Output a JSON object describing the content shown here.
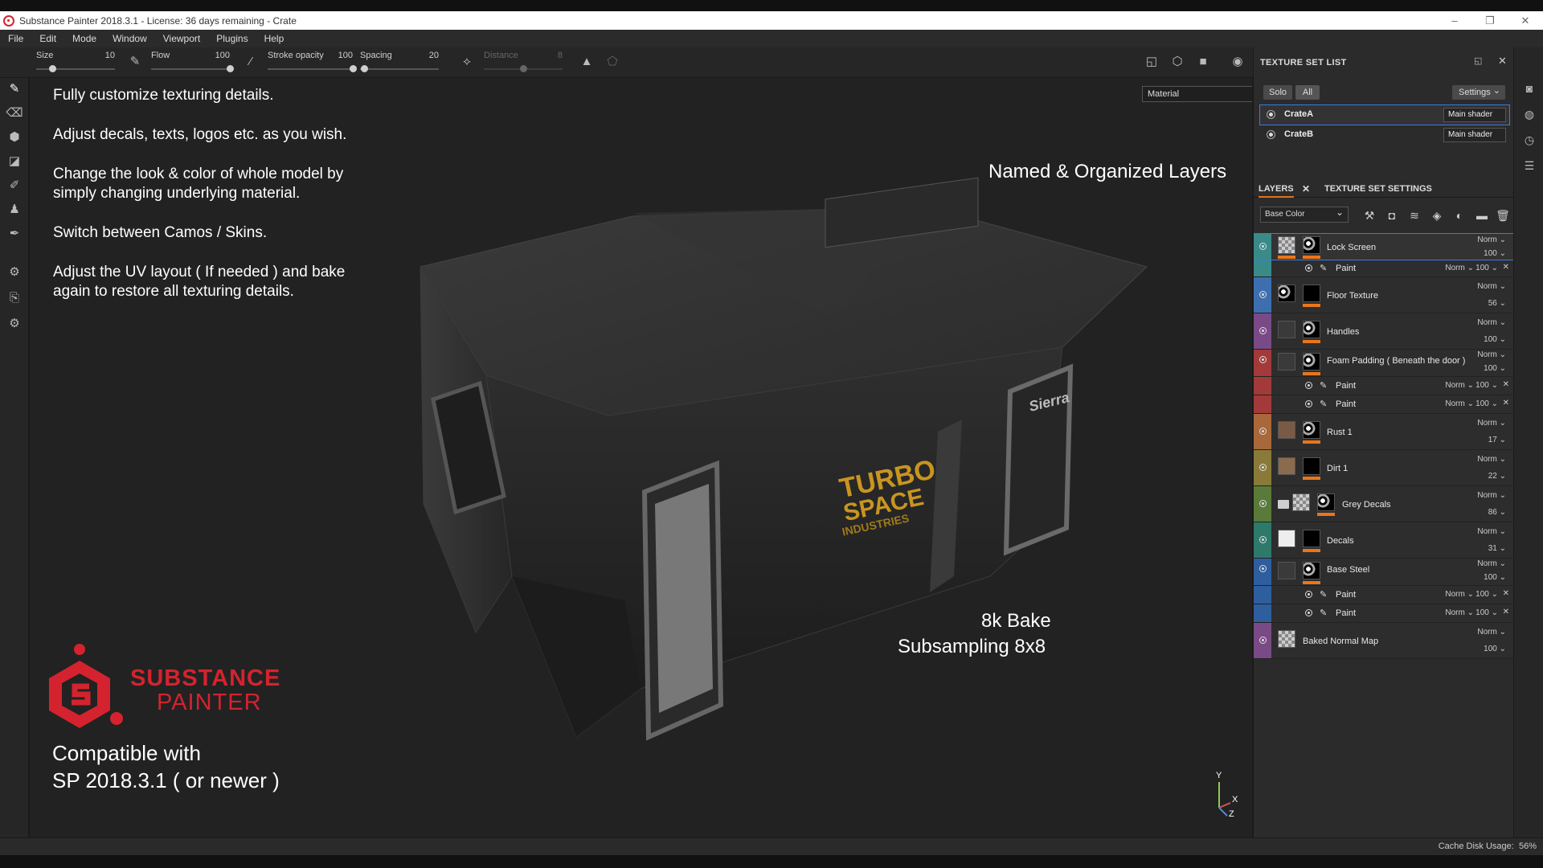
{
  "window": {
    "title": "Substance Painter 2018.3.1 - License: 36 days remaining - Crate",
    "controls": [
      "–",
      "❐",
      "✕"
    ]
  },
  "menu": [
    "File",
    "Edit",
    "Mode",
    "Window",
    "Viewport",
    "Plugins",
    "Help"
  ],
  "toolbar": {
    "size": {
      "label": "Size",
      "value": "10",
      "level": 0.2
    },
    "flow": {
      "label": "Flow",
      "value": "100",
      "level": 1.0
    },
    "stroke_opacity": {
      "label": "Stroke opacity",
      "value": "100",
      "level": 1.0
    },
    "spacing": {
      "label": "Spacing",
      "value": "20",
      "level": 0.05
    },
    "distance": {
      "label": "Distance",
      "value": "8",
      "level": 0.5
    }
  },
  "viewport": {
    "material_select": "Material",
    "lines": [
      "Fully customize texturing details.",
      "Adjust decals, texts, logos etc. as you wish.",
      "Change the look & color of whole model by",
      "simply changing underlying material.",
      "Switch between  Camos / Skins.",
      "Adjust the UV layout ( If needed ) and bake",
      "again to restore all texturing details."
    ],
    "named_layers": "Named & Organized Layers",
    "bake_line1": "8k Bake",
    "bake_line2": "Subsampling 8x8",
    "brand_line1": "SUBSTANCE",
    "brand_line2": "PAINTER",
    "compat_line1": "Compatible with",
    "compat_line2": "SP 2018.3.1 ( or newer  )",
    "crate_text1": "TURBO",
    "crate_text2": "SPACE",
    "crate_text3": "INDUSTRIES",
    "crate_side": "Sierra",
    "axis_y": "Y",
    "axis_x": "X",
    "axis_z": "Z"
  },
  "texture_set_list": {
    "title": "TEXTURE SET LIST",
    "solo": "Solo",
    "all": "All",
    "settings": "Settings",
    "sets": [
      {
        "name": "CrateA",
        "shader": "Main shader"
      },
      {
        "name": "CrateB",
        "shader": "Main shader"
      }
    ]
  },
  "layers_panel": {
    "tab_layers": "LAYERS",
    "tab_settings": "TEXTURE SET SETTINGS",
    "channel": "Base Color",
    "layers": [
      {
        "name": "Lock Screen",
        "blend": "Norm",
        "opacity": "100",
        "color": "#3a8a8a"
      },
      {
        "name": "Paint",
        "blend": "Norm",
        "opacity": "100"
      },
      {
        "name": "Floor Texture",
        "blend": "Norm",
        "opacity": "56",
        "color": "#3d6fb0"
      },
      {
        "name": "Handles",
        "blend": "Norm",
        "opacity": "100",
        "color": "#7a4a86"
      },
      {
        "name": "Foam Padding ( Beneath the door )",
        "blend": "Norm",
        "opacity": "100",
        "color": "#a33a3a"
      },
      {
        "name": "Paint",
        "blend": "Norm",
        "opacity": "100"
      },
      {
        "name": "Paint",
        "blend": "Norm",
        "opacity": "100"
      },
      {
        "name": "Rust 1",
        "blend": "Norm",
        "opacity": "17",
        "color": "#a8683a"
      },
      {
        "name": "Dirt 1",
        "blend": "Norm",
        "opacity": "22",
        "color": "#8a7a3a"
      },
      {
        "name": "Grey Decals",
        "blend": "Norm",
        "opacity": "86",
        "color": "#5a7a3a"
      },
      {
        "name": "Decals",
        "blend": "Norm",
        "opacity": "31",
        "color": "#2e7a6a"
      },
      {
        "name": "Base Steel",
        "blend": "Norm",
        "opacity": "100",
        "color": "#2f5e9e"
      },
      {
        "name": "Paint",
        "blend": "Norm",
        "opacity": "100"
      },
      {
        "name": "Paint",
        "blend": "Norm",
        "opacity": "100"
      },
      {
        "name": "Baked Normal Map",
        "blend": "Norm",
        "opacity": "100",
        "color": "#7a4a86"
      }
    ]
  },
  "status": {
    "cache_label": "Cache Disk Usage:",
    "cache_value": "56%"
  },
  "colors": {
    "accent": "#e8761c",
    "brand_red": "#d4232e",
    "selection": "#3e7ae0"
  }
}
